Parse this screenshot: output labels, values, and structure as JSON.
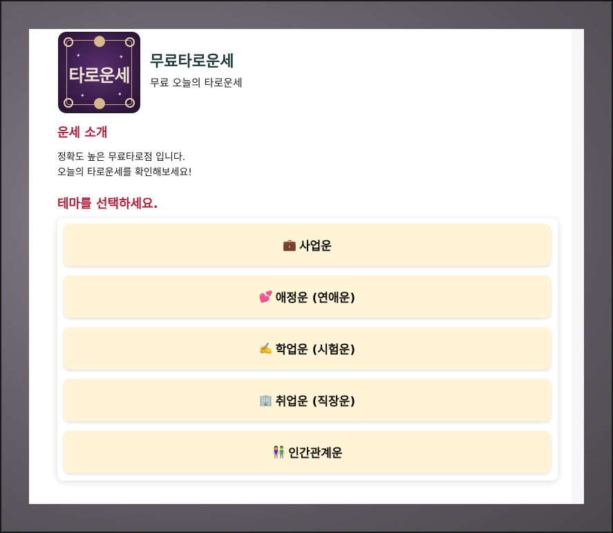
{
  "app": {
    "title": "무료타로운세",
    "subtitle": "무료 오늘의 타로운세",
    "logo_text": "타로운세"
  },
  "intro": {
    "heading": "운세 소개",
    "line1": "정확도 높은 무료타로점 입니다.",
    "line2": "오늘의 타로운세를 확인해보세요!"
  },
  "themes": {
    "heading": "테마를 선택하세요.",
    "items": [
      {
        "icon": "💼",
        "icon_name": "briefcase-icon",
        "label": "사업운"
      },
      {
        "icon": "💕",
        "icon_name": "hearts-icon",
        "label": "애정운 (연애운)"
      },
      {
        "icon": "✍️",
        "icon_name": "writing-hand-icon",
        "label": "학업운 (시험운)"
      },
      {
        "icon": "🏢",
        "icon_name": "office-building-icon",
        "label": "취업운 (직장운)"
      },
      {
        "icon": "👫",
        "icon_name": "people-icon",
        "label": "인간관계운"
      }
    ]
  },
  "colors": {
    "accent": "#b01e3c",
    "title": "#1e3a3a",
    "button_bg": "#fff4d6"
  }
}
